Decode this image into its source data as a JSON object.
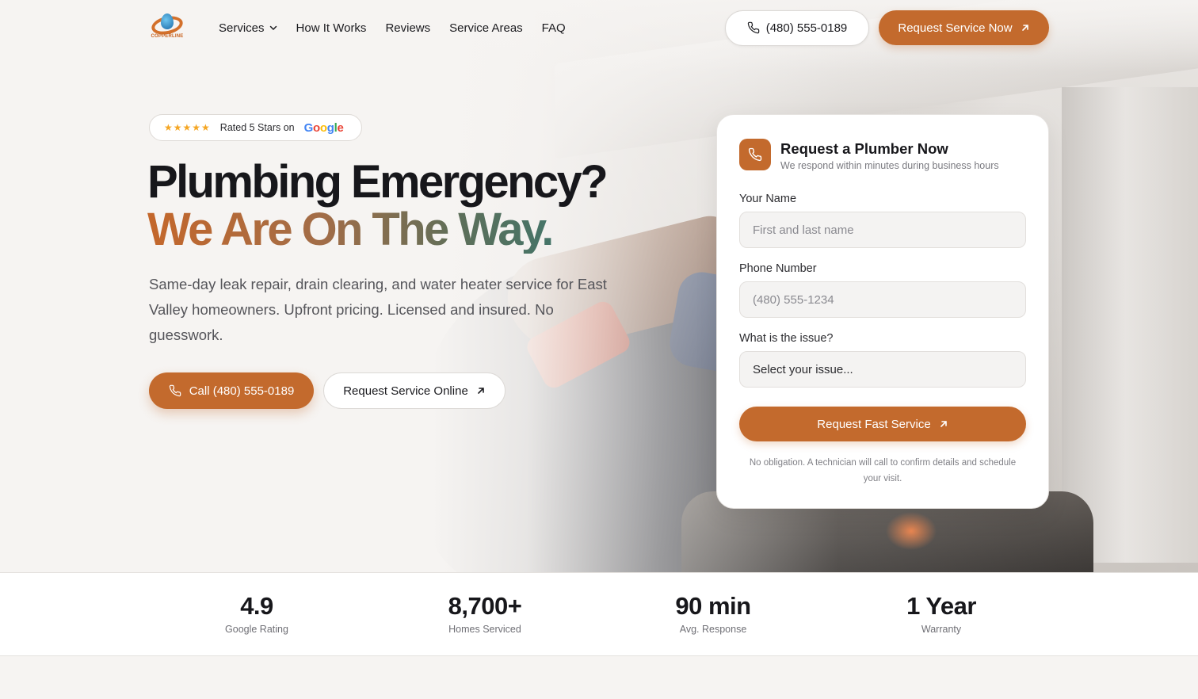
{
  "brand": {
    "logo_text": "COPPERLINE"
  },
  "nav": {
    "items": [
      {
        "label": "Services",
        "has_dropdown": true
      },
      {
        "label": "How It Works"
      },
      {
        "label": "Reviews"
      },
      {
        "label": "Service Areas"
      },
      {
        "label": "FAQ"
      }
    ],
    "phone_label": "(480) 555-0189",
    "cta_label": "Request Service Now"
  },
  "hero": {
    "rating": {
      "stars": "★★★★★",
      "text": "Rated 5 Stars on",
      "platform": "Google"
    },
    "headline": "Plumbing Emergency?",
    "headline_accent": "We Are On The Way.",
    "lede": "Same-day leak repair, drain clearing, and water heater service for East Valley homeowners. Upfront pricing. Licensed and insured. No guesswork.",
    "cta_call": "Call (480) 555-0189",
    "cta_online": "Request Service Online"
  },
  "form": {
    "title": "Request a Plumber Now",
    "subtitle": "We respond within minutes during business hours",
    "name_label": "Your Name",
    "name_placeholder": "First and last name",
    "phone_label": "Phone Number",
    "phone_placeholder": "(480) 555-1234",
    "issue_label": "What is the issue?",
    "issue_value": "Select your issue...",
    "submit_label": "Request Fast Service",
    "note": "No obligation. A technician will call to confirm details and schedule your visit."
  },
  "stats": [
    {
      "value": "4.9",
      "label": "Google Rating"
    },
    {
      "value": "8,700+",
      "label": "Homes Serviced"
    },
    {
      "value": "90 min",
      "label": "Avg. Response"
    },
    {
      "value": "1 Year",
      "label": "Warranty"
    }
  ],
  "colors": {
    "accent": "#c36a2d",
    "accent_teal": "#2a7a78",
    "text": "#17171b"
  }
}
